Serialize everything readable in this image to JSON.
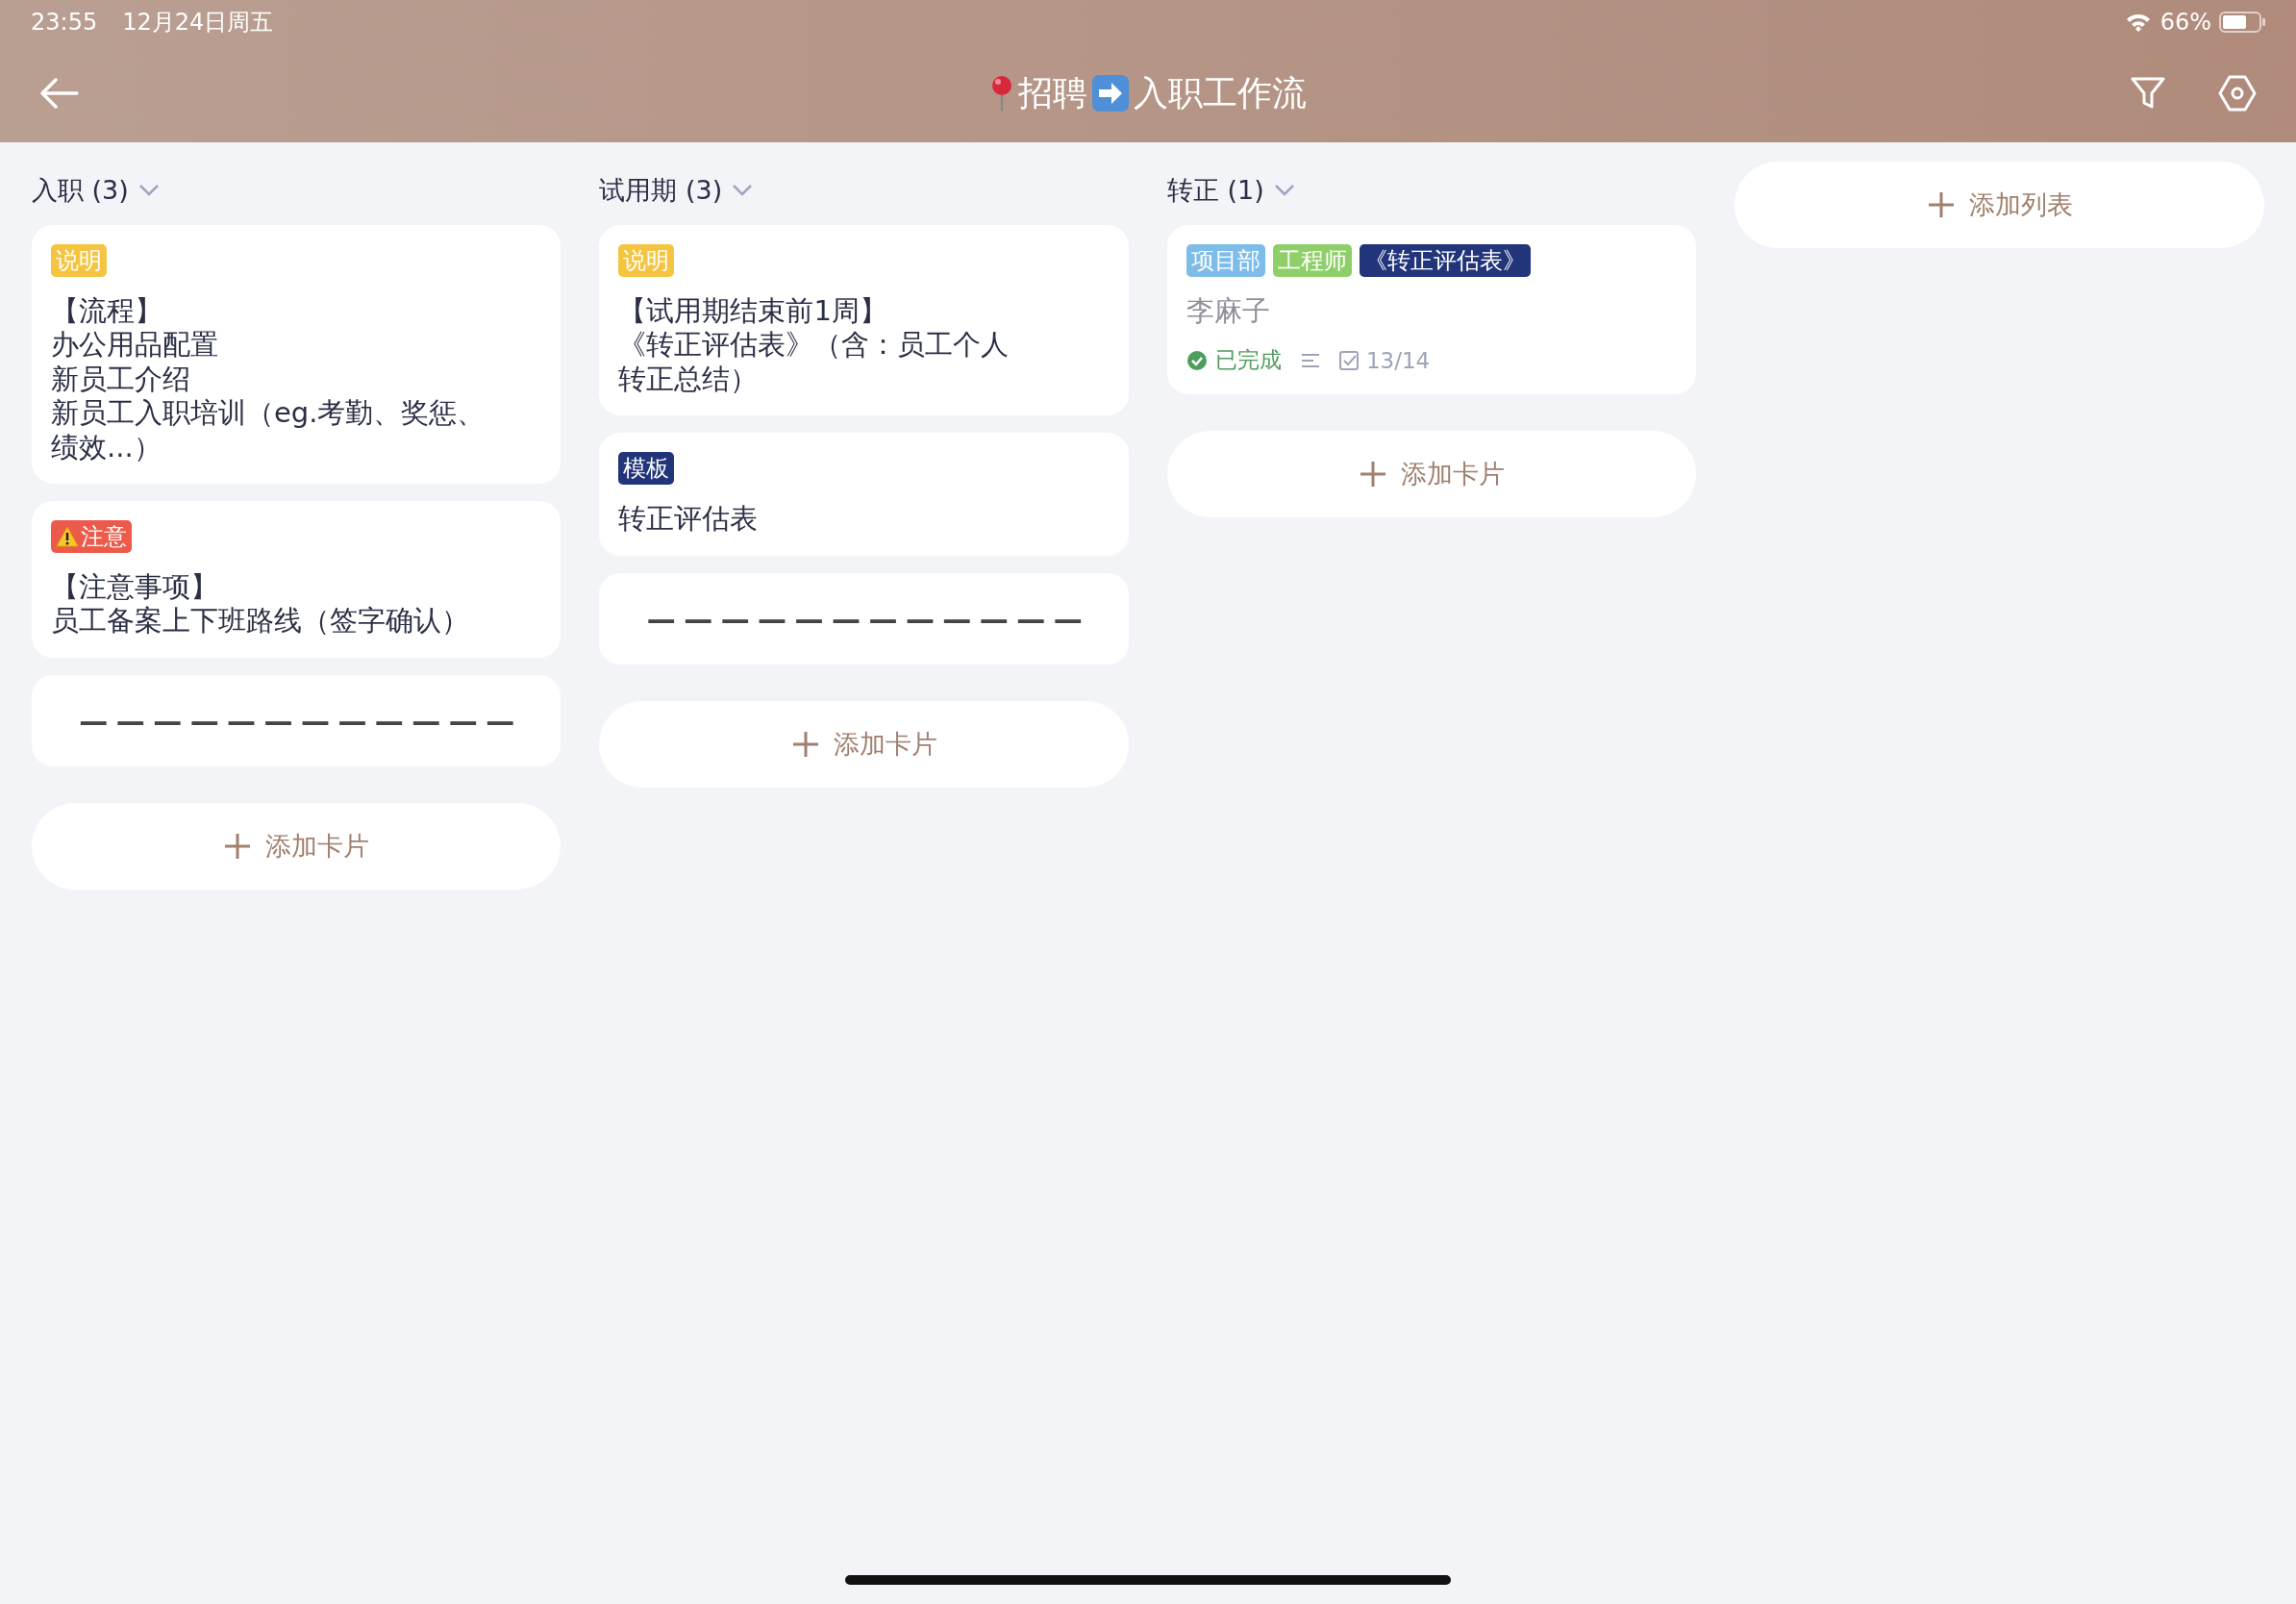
{
  "status_bar": {
    "time": "23:55",
    "date": "12月24日周五",
    "battery": "66%"
  },
  "header": {
    "title_start": "招聘",
    "title_end": "入职工作流"
  },
  "columns": [
    {
      "title": "入职 (3)",
      "cards": [
        {
          "kind": "note",
          "tags": [
            {
              "label": "说明",
              "color": "#f5c542",
              "warning": false
            }
          ],
          "lines": [
            "【流程】",
            "办公用品配置",
            "新员工介绍",
            "新员工入职培训（eg.考勤、奖惩、",
            "绩效...）"
          ]
        },
        {
          "kind": "note",
          "tags": [
            {
              "label": "注意",
              "color": "#ec5a4b",
              "warning": true
            }
          ],
          "lines": [
            "【注意事项】",
            "员工备案上下班路线（签字确认）"
          ]
        },
        {
          "kind": "divider",
          "text": "— — — — — — — — — — — —"
        }
      ],
      "add_label": "添加卡片"
    },
    {
      "title": "试用期 (3)",
      "cards": [
        {
          "kind": "note",
          "tags": [
            {
              "label": "说明",
              "color": "#f5c542",
              "warning": false
            }
          ],
          "lines": [
            "【试用期结束前1周】",
            "《转正评估表》（含：员工个人",
            "转正总结）"
          ]
        },
        {
          "kind": "note",
          "tags": [
            {
              "label": "模板",
              "color": "#22347a",
              "warning": false
            }
          ],
          "lines": [
            "转正评估表"
          ]
        },
        {
          "kind": "divider",
          "text": "— — — — — — — — — — — —"
        }
      ],
      "add_label": "添加卡片"
    },
    {
      "title": "转正 (1)",
      "cards": [
        {
          "kind": "task",
          "tags": [
            {
              "label": "项目部",
              "color": "#7ebde9",
              "warning": false
            },
            {
              "label": "工程师",
              "color": "#8fcf6a",
              "warning": false
            },
            {
              "label": "《转正评估表》",
              "color": "#22347a",
              "warning": false
            }
          ],
          "lines": [
            "李麻子"
          ],
          "status": "已完成",
          "checklist": "13/14"
        }
      ],
      "add_label": "添加卡片"
    }
  ],
  "add_list": "添加列表"
}
